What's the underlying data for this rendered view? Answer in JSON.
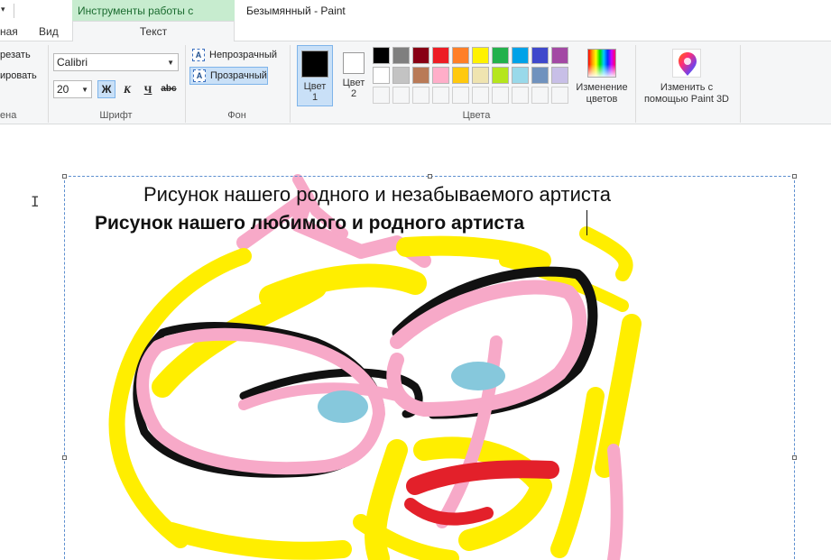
{
  "titlebar": {
    "quick_access_arrow": "▾",
    "context_group": "Инструменты работы с текстом",
    "window_title": "Безымянный - Paint"
  },
  "tabs": {
    "home": "ная",
    "view": "Вид",
    "text": "Текст"
  },
  "clipboard": {
    "cut": "резать",
    "copy": "ировать",
    "label": "ена"
  },
  "font": {
    "family": "Calibri",
    "size": "20",
    "bold": "Ж",
    "italic": "К",
    "underline": "Ч",
    "strike": "abc",
    "label": "Шрифт"
  },
  "background": {
    "opaque": "Непрозрачный",
    "transparent": "Прозрачный",
    "label": "Фон",
    "icon_glyph": "A"
  },
  "colors": {
    "color1_line1": "Цвет",
    "color1_line2": "1",
    "color2_line1": "Цвет",
    "color2_line2": "2",
    "color1_value": "#000000",
    "color2_value": "#ffffff",
    "label": "Цвета",
    "edit_line1": "Изменение",
    "edit_line2": "цветов",
    "palette_row1": [
      "#000000",
      "#7f7f7f",
      "#880015",
      "#ed1c24",
      "#ff7f27",
      "#fff200",
      "#22b14c",
      "#00a2e8",
      "#3f48cc",
      "#a349a4"
    ],
    "palette_row2": [
      "#ffffff",
      "#c3c3c3",
      "#b97a57",
      "#ffaec9",
      "#ffc90e",
      "#efe4b0",
      "#b5e61d",
      "#99d9ea",
      "#7092be",
      "#c8bfe7"
    ],
    "palette_row3_count": 10
  },
  "paint3d": {
    "line1": "Изменить с",
    "line2": "помощью Paint 3D"
  },
  "canvas": {
    "text_line1": "Рисунок нашего родного и незабываемого артиста",
    "text_line2": "Рисунок нашего любимого и родного артиста",
    "drawing_colors": {
      "yellow": "#ffee00",
      "pink": "#f7a9c8",
      "black": "#111111",
      "blue": "#86c8dc",
      "red": "#e3202a"
    }
  }
}
